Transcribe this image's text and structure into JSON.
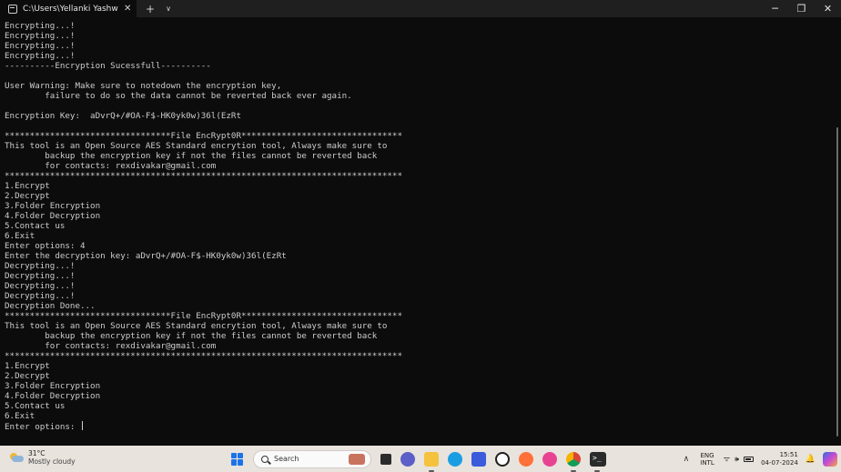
{
  "window": {
    "tab_title": "C:\\Users\\Yellanki Yashwanth\\D",
    "tab_close": "✕",
    "new_tab": "+",
    "tab_dropdown": "∨",
    "minimize": "─",
    "maximize": "❐",
    "close": "✕"
  },
  "terminal": {
    "lines": [
      "Encrypting...!",
      "Encrypting...!",
      "Encrypting...!",
      "Encrypting...!",
      "----------Encryption Sucessfull----------",
      "",
      "User Warning: Make sure to notedown the encryption key,",
      "        failure to do so the data cannot be reverted back ever again.",
      "",
      "Encryption Key:  aDvrQ+/#OA-F$-HK0yk0w)36l(EzRt",
      "",
      "*********************************File EncRypt0R********************************",
      "This tool is an Open Source AES Standard encrytion tool, Always make sure to",
      "        backup the encryption key if not the files cannot be reverted back",
      "        for contacts: rexdivakar@gmail.com",
      "*******************************************************************************",
      "1.Encrypt",
      "2.Decrypt",
      "3.Folder Encryption",
      "4.Folder Decryption",
      "5.Contact us",
      "6.Exit",
      "Enter options: 4",
      "Enter the decryption key: aDvrQ+/#OA-F$-HK0yk0w)36l(EzRt",
      "Decrypting...!",
      "Decrypting...!",
      "Decrypting...!",
      "Decrypting...!",
      "Decryption Done...",
      "*********************************File EncRypt0R********************************",
      "This tool is an Open Source AES Standard encrytion tool, Always make sure to",
      "        backup the encryption key if not the files cannot be reverted back",
      "        for contacts: rexdivakar@gmail.com",
      "*******************************************************************************",
      "1.Encrypt",
      "2.Decrypt",
      "3.Folder Encryption",
      "4.Folder Decryption",
      "5.Contact us",
      "6.Exit"
    ],
    "prompt": "Enter options: "
  },
  "taskbar": {
    "weather_temp": "31°C",
    "weather_desc": "Mostly cloudy",
    "search_placeholder": "Search",
    "tray_chevron": "∧",
    "lang_line1": "ENG",
    "lang_line2": "INTL",
    "wifi_icon": "ᯤ",
    "volume_icon": "🕪",
    "time": "15:51",
    "date": "04-07-2024",
    "bell_icon": "🔔"
  },
  "colors": {
    "terminal_bg": "#0c0c0c",
    "terminal_fg": "#cccccc",
    "titlebar_bg": "#1f1f1f",
    "taskbar_bg": "#e9e3dd"
  }
}
